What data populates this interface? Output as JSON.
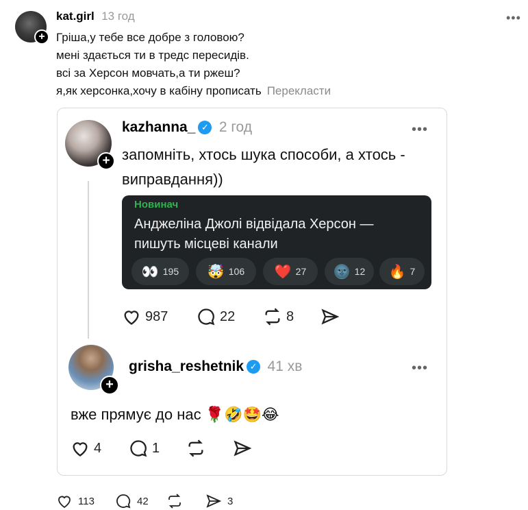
{
  "post": {
    "username": "kat.girl",
    "time": "13 год",
    "lines": [
      "Гріша,у тебе все добре з головою?",
      "мені здається ти в тредс пересидів.",
      "всі за Херсон мовчать,а ти ржеш?",
      "я,як херсонка,хочу в кабіну прописать"
    ],
    "translate": "Перекласти",
    "menu": "•••",
    "stats": {
      "likes": "113",
      "comments": "42",
      "reposts": "",
      "shares": "3"
    }
  },
  "quoted": {
    "username": "kazhanna_",
    "time": "2 год",
    "menu": "•••",
    "text_line1": "запомніть, хтось шука способи, а хтось -",
    "text_line2": "виправдання))",
    "news": {
      "tag": "Новинач",
      "title": "Анджеліна Джолі відвідала Херсон — пишуть місцеві канали",
      "reactions": [
        {
          "emoji": "👀",
          "count": "195"
        },
        {
          "emoji": "🤯",
          "count": "106"
        },
        {
          "emoji": "❤️",
          "count": "27"
        },
        {
          "emoji": "🌚",
          "count": "12"
        },
        {
          "emoji": "🔥",
          "count": "7"
        }
      ]
    },
    "stats": {
      "likes": "987",
      "comments": "22",
      "reposts": "8"
    }
  },
  "reply": {
    "username": "grisha_reshetnik",
    "time": "41 хв",
    "menu": "•••",
    "text": "вже прямує до нас 🌹🤣🤩😂",
    "stats": {
      "likes": "4",
      "comments": "1"
    }
  },
  "icons": {
    "plus": "+",
    "verified": "✓"
  },
  "colors": {
    "verified_blue": "#1d9bf0",
    "news_bg": "#1f2326",
    "news_tag_green": "#2fb34f",
    "muted_gray": "#999999"
  }
}
